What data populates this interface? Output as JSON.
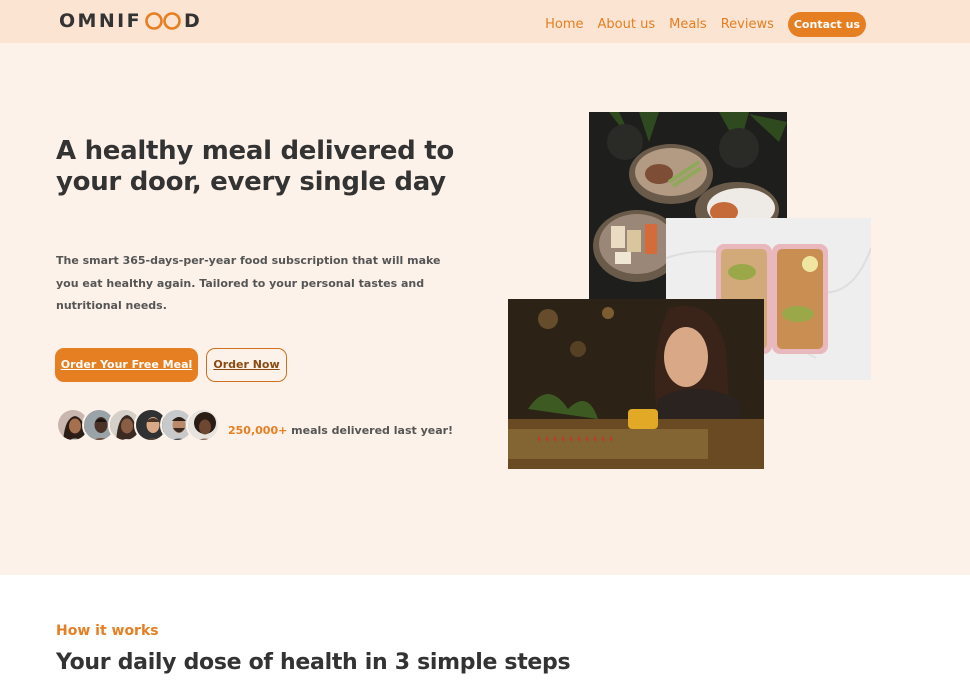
{
  "header": {
    "logo_before": "OMNIF",
    "logo_after": "D",
    "nav": [
      {
        "label": "Home"
      },
      {
        "label": "About us"
      },
      {
        "label": "Meals"
      },
      {
        "label": "Reviews"
      }
    ],
    "contact_label": "Contact us"
  },
  "hero": {
    "title": "A healthy meal delivered to your door, every single day",
    "description": "The smart 365-days-per-year food subscription that will make you eat healthy again. Tailored to your personal tastes and nutritional needs.",
    "primary_button": "Order Your Free Meal",
    "secondary_button": "Order Now",
    "delivered_count": "250,000+",
    "delivered_text": " meals delivered last year!"
  },
  "how_it_works": {
    "subheading": "How it works",
    "heading": "Your daily dose of health in 3 simple steps"
  },
  "colors": {
    "accent": "#e67e22",
    "header_bg": "#fbe4d1",
    "hero_bg": "#fdf2e9",
    "text": "#333333"
  }
}
